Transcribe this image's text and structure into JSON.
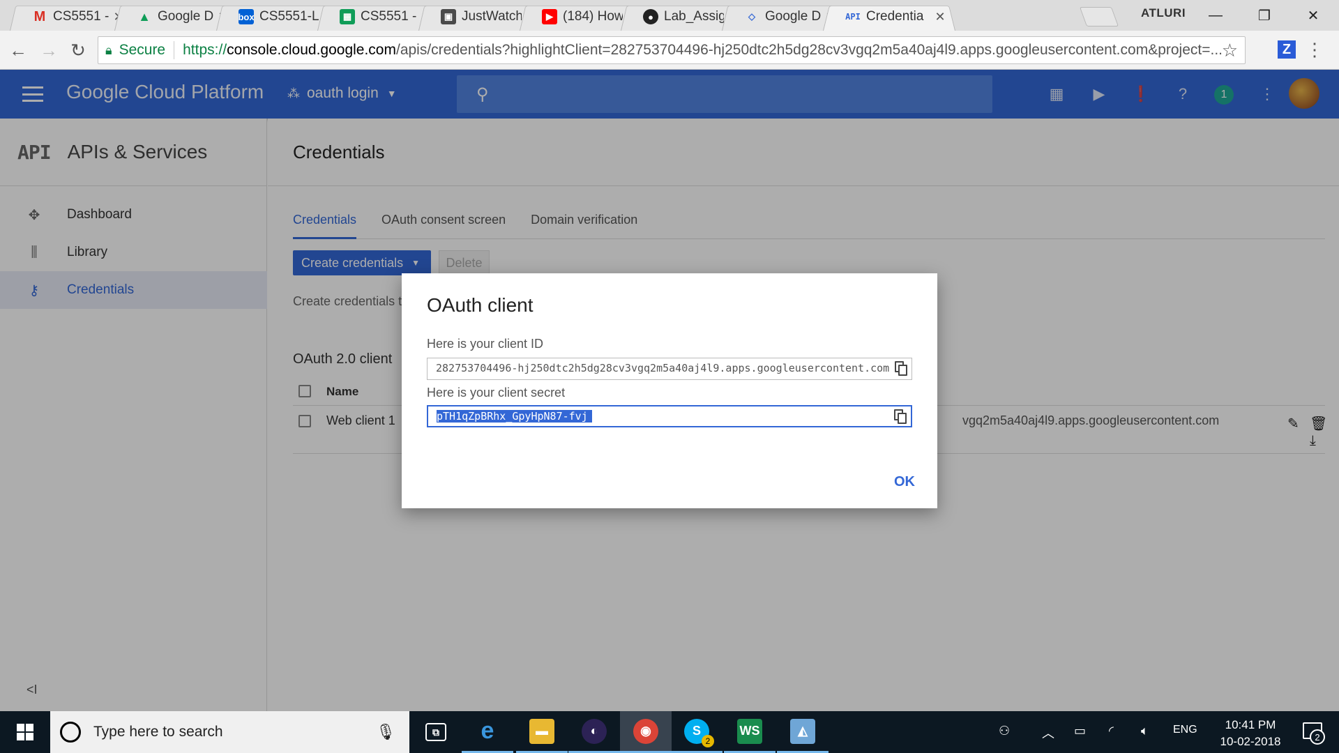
{
  "browser": {
    "tabs": [
      {
        "title": "CS5551 -",
        "icon": "gmail-icon",
        "color": "#ffffff",
        "glyph": "M"
      },
      {
        "title": "Google D",
        "icon": "google-drive-icon",
        "color": "#fbbc05",
        "glyph": "▲"
      },
      {
        "title": "CS5551-L",
        "icon": "box-icon",
        "color": "#0061d5",
        "glyph": "box"
      },
      {
        "title": "CS5551 -",
        "icon": "google-sheets-icon",
        "color": "#0f9d58",
        "glyph": "▦"
      },
      {
        "title": "JustWatch",
        "icon": "justwatch-icon",
        "color": "#4a4a4a",
        "glyph": "▣"
      },
      {
        "title": "(184) How",
        "icon": "youtube-icon",
        "color": "#ff0000",
        "glyph": "▶"
      },
      {
        "title": "Lab_Assig",
        "icon": "github-icon",
        "color": "#222222",
        "glyph": "●"
      },
      {
        "title": "Google D",
        "icon": "google-developers-icon",
        "color": "#ffffff",
        "glyph": "◇"
      },
      {
        "title": "Credentia",
        "icon": "api-icon",
        "color": "#ffffff",
        "glyph": "API",
        "active": true
      }
    ],
    "profile_name": "ATLURI",
    "window_controls": {
      "minimize": "—",
      "restore": "❐",
      "close": "✕"
    },
    "address": {
      "secure_label": "Secure",
      "scheme": "https://",
      "domain": "console.cloud.google.com",
      "path": "/apis/credentials?highlightClient=282753704496-hj250dtc2h5dg28cv3vgq2m5a40aj4l9.apps.googleusercontent.com&project=..."
    },
    "extension_letter": "Z"
  },
  "header": {
    "brand": "Google Cloud Platform",
    "project": "oauth login",
    "notification_count": "1"
  },
  "sidebar": {
    "logo_text": "API",
    "title": "APIs & Services",
    "items": [
      {
        "label": "Dashboard",
        "icon": "dashboard-icon"
      },
      {
        "label": "Library",
        "icon": "library-icon"
      },
      {
        "label": "Credentials",
        "icon": "key-icon",
        "active": true
      }
    ],
    "collapse_label": "<I"
  },
  "main": {
    "page_title": "Credentials",
    "tabs": [
      "Credentials",
      "OAuth consent screen",
      "Domain verification"
    ],
    "create_button": "Create credentials",
    "delete_button": "Delete",
    "hint_text": "Create credentials t",
    "section_title": "OAuth 2.0 client",
    "table": {
      "name_header": "Name",
      "rows": [
        {
          "name": "Web client 1",
          "client_id_tail": "vgq2m5a40aj4l9.apps.googleusercontent.com"
        }
      ]
    }
  },
  "dialog": {
    "title": "OAuth client",
    "client_id_label": "Here is your client ID",
    "client_id": "282753704496-hj250dtc2h5dg28cv3vgq2m5a40aj4l9.apps.googleusercontent.com",
    "client_secret_label": "Here is your client secret",
    "client_secret": "pTH1qZpBRhx_GpyHpN87-fvj",
    "ok_button": "OK"
  },
  "taskbar": {
    "search_placeholder": "Type here to search",
    "apps": [
      {
        "name": "task-view-icon",
        "glyph": "⧉"
      },
      {
        "name": "edge-icon",
        "glyph": "e",
        "color": "#1e73be"
      },
      {
        "name": "file-explorer-icon",
        "glyph": "▬",
        "color": "#e8b832"
      },
      {
        "name": "eclipse-icon",
        "glyph": "◐",
        "color": "#2c2255"
      },
      {
        "name": "chrome-icon",
        "glyph": "◉",
        "color": "#db4437",
        "active": true
      },
      {
        "name": "skype-icon",
        "glyph": "S",
        "color": "#00aff0",
        "badge": "2"
      },
      {
        "name": "webstorm-icon",
        "glyph": "WS",
        "color": "#1a8c4e"
      },
      {
        "name": "sticky-app-icon",
        "glyph": "◭",
        "color": "#6fa6d6"
      }
    ],
    "language": "ENG",
    "time": "10:41 PM",
    "date": "10-02-2018",
    "notification_count": "2"
  }
}
